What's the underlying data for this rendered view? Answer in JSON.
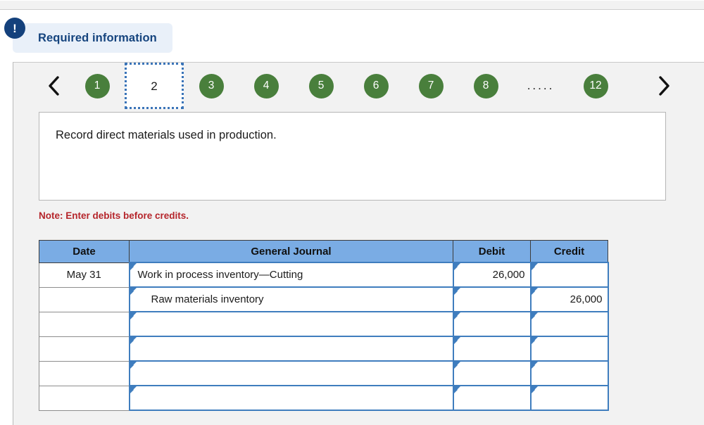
{
  "banner": {
    "icon": "exclamation-icon",
    "icon_glyph": "!",
    "label": "Required information"
  },
  "pager": {
    "prev_label": "‹",
    "next_label": "›",
    "ellipsis": ".....",
    "current": "2",
    "steps": [
      {
        "label": "1",
        "state": "done"
      },
      {
        "label": "2",
        "state": "current"
      },
      {
        "label": "3",
        "state": "done"
      },
      {
        "label": "4",
        "state": "done"
      },
      {
        "label": "5",
        "state": "done"
      },
      {
        "label": "6",
        "state": "done"
      },
      {
        "label": "7",
        "state": "done"
      },
      {
        "label": "8",
        "state": "done"
      },
      {
        "label": "12",
        "state": "done"
      }
    ]
  },
  "instruction": {
    "text": "Record direct materials used in production."
  },
  "note": {
    "text": "Note: Enter debits before credits."
  },
  "journal": {
    "columns": [
      "Date",
      "General Journal",
      "Debit",
      "Credit"
    ],
    "rows": [
      {
        "date": "May 31",
        "account": "Work in process inventory—Cutting",
        "indent": false,
        "debit": "26,000",
        "credit": ""
      },
      {
        "date": "",
        "account": "Raw materials inventory",
        "indent": true,
        "debit": "",
        "credit": "26,000"
      },
      {
        "date": "",
        "account": "",
        "indent": false,
        "debit": "",
        "credit": ""
      },
      {
        "date": "",
        "account": "",
        "indent": false,
        "debit": "",
        "credit": ""
      },
      {
        "date": "",
        "account": "",
        "indent": false,
        "debit": "",
        "credit": ""
      },
      {
        "date": "",
        "account": "",
        "indent": false,
        "debit": "",
        "credit": ""
      }
    ]
  },
  "colors": {
    "header_blue": "#7aace4",
    "field_border_blue": "#3f7dbe",
    "step_green": "#497f3c",
    "note_red": "#b5252b",
    "banner_navy": "#14417c",
    "banner_bg": "#e9f0f9"
  }
}
